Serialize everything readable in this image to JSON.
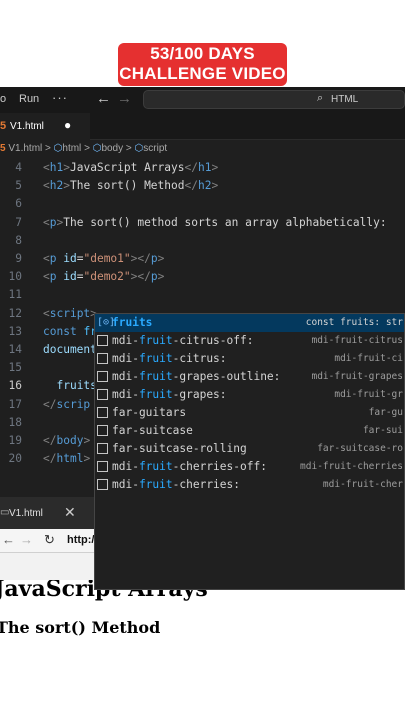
{
  "caption": {
    "line1": "53/100 DAYS",
    "line2": "CHALLENGE VIDEO"
  },
  "titlebar": {
    "menu": "o",
    "run": "Run",
    "more": "···",
    "back": "←",
    "forward": "→",
    "search_icon": "search-icon",
    "search_text": "HTML"
  },
  "tab": {
    "label": "V1.html",
    "icon": "html5-icon"
  },
  "breadcrumb": {
    "file": "V1.html",
    "items": [
      "html",
      "body",
      "script"
    ]
  },
  "code_lines": [
    {
      "n": "4",
      "html": "<span class=\"br\">&lt;</span><span class=\"tag\">h1</span><span class=\"br\">&gt;</span>JavaScript Arrays<span class=\"br\">&lt;/</span><span class=\"tag\">h1</span><span class=\"br\">&gt;</span>"
    },
    {
      "n": "5",
      "html": "<span class=\"br\">&lt;</span><span class=\"tag\">h2</span><span class=\"br\">&gt;</span>The sort() Method<span class=\"br\">&lt;/</span><span class=\"tag\">h2</span><span class=\"br\">&gt;</span>"
    },
    {
      "n": "6",
      "html": ""
    },
    {
      "n": "7",
      "html": "<span class=\"br\">&lt;</span><span class=\"tag\">p</span><span class=\"br\">&gt;</span>The sort() method sorts an array alphabetically:"
    },
    {
      "n": "8",
      "html": ""
    },
    {
      "n": "9",
      "html": "<span class=\"br\">&lt;</span><span class=\"tag\">p</span> <span class=\"attr\">id</span>=<span class=\"str\">\"demo1\"</span><span class=\"br\">&gt;&lt;/</span><span class=\"tag\">p</span><span class=\"br\">&gt;</span>"
    },
    {
      "n": "10",
      "html": "<span class=\"br\">&lt;</span><span class=\"tag\">p</span> <span class=\"attr\">id</span>=<span class=\"str\">\"demo2\"</span><span class=\"br\">&gt;&lt;/</span><span class=\"tag\">p</span><span class=\"br\">&gt;</span>"
    },
    {
      "n": "11",
      "html": ""
    },
    {
      "n": "12",
      "html": "<span class=\"br\">&lt;</span><span class=\"tag\">script</span><span class=\"br\">&gt;</span>"
    },
    {
      "n": "13",
      "html": "<span class=\"kw\">const</span> <span class=\"var\">fruits</span> = [<span class=\"str\">\"Banana\"</span>, <span class=\"str\">\"Orange\"</span>, <span class=\"str\">\"Apple\"</span>, <span class=\"str\">\"Mango\"</span>"
    },
    {
      "n": "14",
      "html": "<span class=\"prop\">document</span>.<span class=\"fn\">getElementById</span>(<span class=\"str\">\"demo1\"</span>).<span class=\"prop\">innerHTML</span> = <span class=\"var\">fruits</span>"
    },
    {
      "n": "15",
      "html": ""
    },
    {
      "n": "16",
      "html": "  <span class=\"prop\">fruits</span>"
    },
    {
      "n": "17",
      "html": "<span class=\"br\">&lt;/</span><span class=\"tag\">scrip</span>"
    },
    {
      "n": "18",
      "html": ""
    },
    {
      "n": "19",
      "html": "<span class=\"br\">&lt;/</span><span class=\"tag\">body</span><span class=\"br\">&gt;</span>"
    },
    {
      "n": "20",
      "html": "<span class=\"br\">&lt;/</span><span class=\"tag\">html</span><span class=\"br\">&gt;</span>"
    }
  ],
  "suggestions": [
    {
      "label": "fruits",
      "match": "fruits",
      "detail": "const fruits: str",
      "kind": "variable"
    },
    {
      "label": "mdi-fruit-citrus-off:",
      "match": "fruit",
      "detail": "mdi-fruit-citrus",
      "kind": "snippet"
    },
    {
      "label": "mdi-fruit-citrus:",
      "match": "fruit",
      "detail": "mdi-fruit-ci",
      "kind": "snippet"
    },
    {
      "label": "mdi-fruit-grapes-outline:",
      "match": "fruit",
      "detail": "mdi-fruit-grapes",
      "kind": "snippet"
    },
    {
      "label": "mdi-fruit-grapes:",
      "match": "fruit",
      "detail": "mdi-fruit-gr",
      "kind": "snippet"
    },
    {
      "label": "far-guitars",
      "match": "",
      "detail": "far-gu",
      "kind": "snippet"
    },
    {
      "label": "far-suitcase",
      "match": "",
      "detail": "far-sui",
      "kind": "snippet"
    },
    {
      "label": "far-suitcase-rolling",
      "match": "",
      "detail": "far-suitcase-ro",
      "kind": "snippet"
    },
    {
      "label": "mdi-fruit-cherries-off:",
      "match": "fruit",
      "detail": "mdi-fruit-cherries",
      "kind": "snippet"
    },
    {
      "label": "mdi-fruit-cherries:",
      "match": "fruit",
      "detail": "mdi-fruit-cher",
      "kind": "snippet"
    }
  ],
  "browser": {
    "tab_label": "V1.html",
    "close": "✕",
    "url": "http:/",
    "h1": "JavaScript Arrays",
    "h2": "The sort() Method"
  },
  "colors": {
    "badge": "#e53030",
    "editor_bg": "#1f1f1f",
    "selected": "#04395e",
    "match": "#2aaaff"
  }
}
